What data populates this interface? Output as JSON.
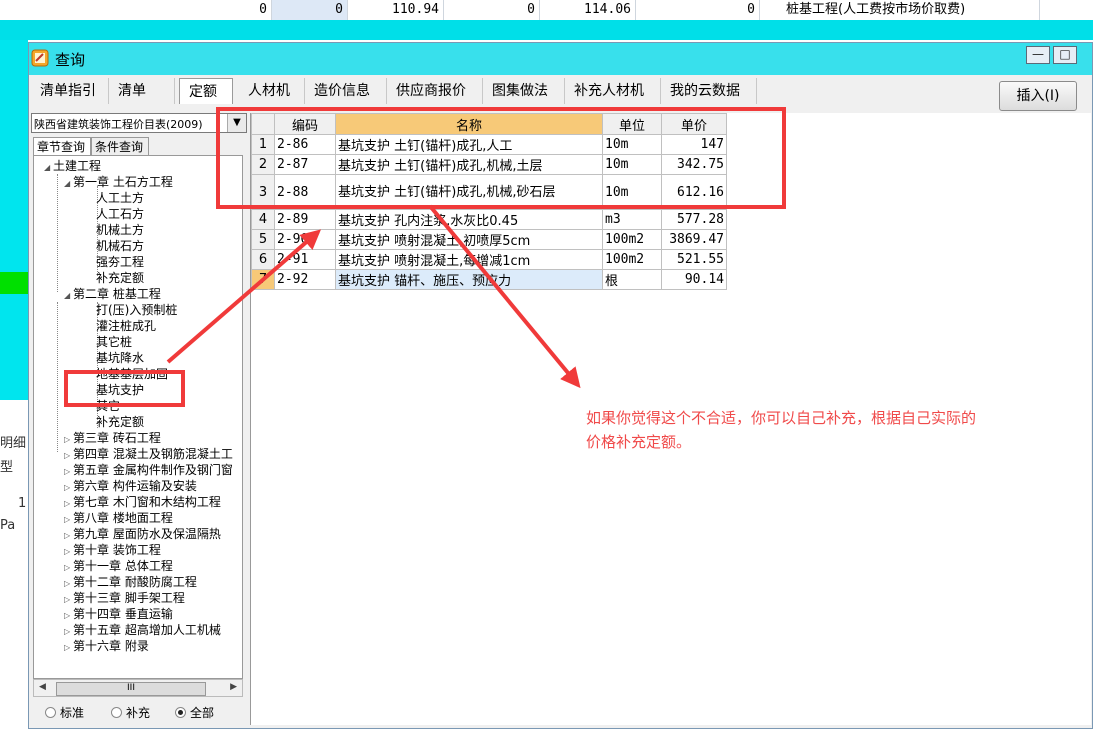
{
  "background": {
    "top_row": [
      "0",
      "0",
      "110.94",
      "0",
      "114.06",
      "0"
    ],
    "top_row_text": "桩基工程(人工费按市场价取费)",
    "side_texts": [
      "明细",
      "型",
      "1",
      "Pa"
    ]
  },
  "dialog": {
    "title": "查询",
    "window_buttons": {
      "minimize": "—",
      "maximize": "□"
    },
    "tabs": [
      "清单指引",
      "清单",
      "定额",
      "人材机",
      "造价信息",
      "供应商报价",
      "图集做法",
      "补充人材机",
      "我的云数据"
    ],
    "active_tab": "定额",
    "insert_button": "插入(I)"
  },
  "left_panel": {
    "library_select": "陕西省建筑装饰工程价目表(2009)",
    "subtabs": [
      "章节查询",
      "条件查询"
    ],
    "tree": {
      "root": "土建工程",
      "chapter1": {
        "label": "第一章 土石方工程",
        "items": [
          "人工土方",
          "人工石方",
          "机械土方",
          "机械石方",
          "强夯工程",
          "补充定额"
        ]
      },
      "chapter2": {
        "label": "第二章 桩基工程",
        "items": [
          "打(压)入预制桩",
          "灌注桩成孔",
          "其它桩",
          "基坑降水",
          "地基基层加固",
          "基坑支护",
          "其它",
          "补充定额"
        ]
      },
      "chapters": [
        "第三章 砖石工程",
        "第四章 混凝土及钢筋混凝土工",
        "第五章 金属构件制作及钢门窗",
        "第六章 构件运输及安装",
        "第七章 木门窗和木结构工程",
        "第八章 楼地面工程",
        "第九章 屋面防水及保温隔热",
        "第十章 装饰工程",
        "第十一章 总体工程",
        "第十二章 耐酸防腐工程",
        "第十三章 脚手架工程",
        "第十四章 垂直运输",
        "第十五章 超高增加人工机械",
        "第十六章 附录"
      ]
    },
    "scroll_thumb": "III",
    "radios": [
      "标准",
      "补充",
      "全部"
    ],
    "radio_selected": "全部"
  },
  "grid": {
    "headers": {
      "code": "编码",
      "name": "名称",
      "unit": "单位",
      "price": "单价"
    },
    "rows": [
      {
        "n": "1",
        "code": "2-86",
        "name": "基坑支护 土钉(锚杆)成孔,人工",
        "unit": "10m",
        "price": "147"
      },
      {
        "n": "2",
        "code": "2-87",
        "name": "基坑支护 土钉(锚杆)成孔,机械,土层",
        "unit": "10m",
        "price": "342.75"
      },
      {
        "n": "3",
        "code": "2-88",
        "name": "基坑支护 土钉(锚杆)成孔,机械,砂石层",
        "unit": "10m",
        "price": "612.16"
      },
      {
        "n": "4",
        "code": "2-89",
        "name": "基坑支护 孔内注浆,水灰比0.45",
        "unit": "m3",
        "price": "577.28"
      },
      {
        "n": "5",
        "code": "2-90",
        "name": "基坑支护 喷射混凝土,初喷厚5cm",
        "unit": "100m2",
        "price": "3869.47"
      },
      {
        "n": "6",
        "code": "2-91",
        "name": "基坑支护 喷射混凝土,每增减1cm",
        "unit": "100m2",
        "price": "521.55"
      },
      {
        "n": "7",
        "code": "2-92",
        "name": "基坑支护 锚杆、施压、预应力",
        "unit": "根",
        "price": "90.14"
      }
    ]
  },
  "annotation": {
    "text_line1": "如果你觉得这个不合适，你可以自己补充，根据自己实际的",
    "text_line2": "价格补充定额。",
    "color": "#f03a3a"
  }
}
